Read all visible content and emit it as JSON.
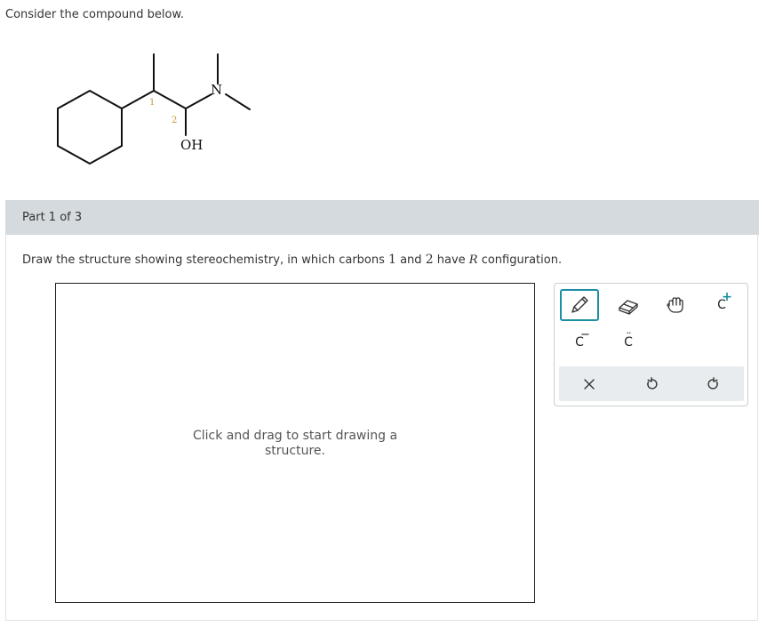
{
  "intro_text": "Consider the compound below.",
  "molecule": {
    "atom_n": "N",
    "group_oh": "OH",
    "locant_1": "1",
    "locant_2": "2"
  },
  "part": {
    "label": "Part 1 of 3"
  },
  "question": {
    "prefix": "Draw the structure showing stereochemistry, in which carbons ",
    "num1": "1",
    "and_text": " and ",
    "num2": "2",
    "have_text": " have ",
    "config": "R",
    "suffix": " configuration."
  },
  "canvas": {
    "hint_line1": "Click and drag to start drawing a",
    "hint_line2": "structure."
  },
  "toolbar": {
    "tools": [
      {
        "icon": "pencil-icon"
      },
      {
        "icon": "eraser-icon"
      },
      {
        "icon": "hand-icon"
      },
      {
        "text": "C",
        "sup": "+"
      },
      {
        "text": "C",
        "sup": "−"
      },
      {
        "text": "C",
        "dots": "··"
      }
    ],
    "actions": [
      {
        "icon": "clear-x-icon"
      },
      {
        "icon": "undo-icon"
      },
      {
        "icon": "redo-icon"
      }
    ]
  },
  "colors": {
    "accent": "#1a8ea3",
    "locant": "#c79a3b",
    "header_bg": "#d4dadd"
  }
}
